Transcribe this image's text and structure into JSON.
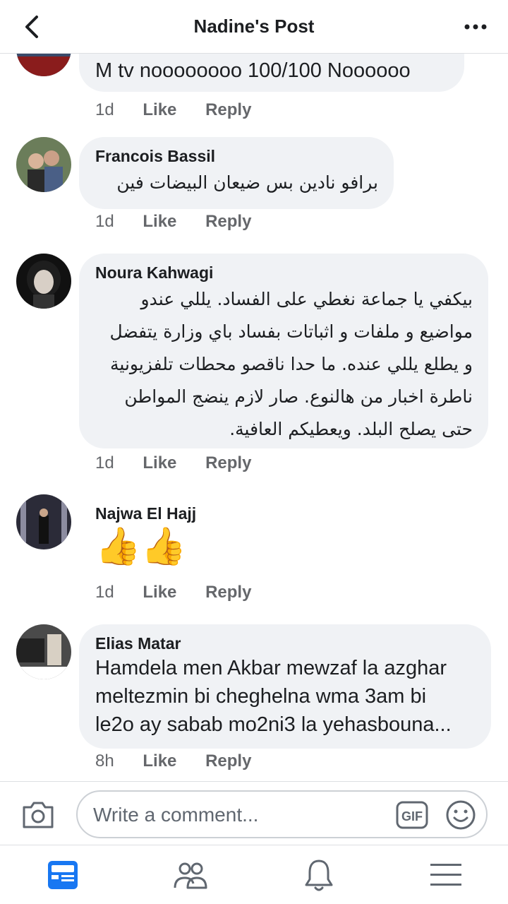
{
  "header": {
    "title": "Nadine's Post"
  },
  "comments": [
    {
      "author": "",
      "text": "M tv noooooooo 100/100 Noooooo",
      "time": "1d",
      "like": "Like",
      "reply": "Reply"
    },
    {
      "author": "Francois Bassil",
      "text": "برافو نادين    بس ضيعان البيضات فين",
      "time": "1d",
      "like": "Like",
      "reply": "Reply"
    },
    {
      "author": "Noura Kahwagi",
      "lines": [
        "بيكفي يا جماعة نغطي على الفساد. يللي عندو",
        "مواضيع و ملفات و اثباتات بفساد باي وزارة يتفضل",
        "و يطلع يللي عنده. ما حدا ناقصو محطات تلفزيونية",
        "ناطرة اخبار من هالنوع. صار لازم ينضج المواطن",
        "حتى يصلح البلد. ويعطيكم العافية."
      ],
      "time": "1d",
      "like": "Like",
      "reply": "Reply"
    },
    {
      "author": "Najwa El Hajj",
      "emoji": "👍👍",
      "time": "1d",
      "like": "Like",
      "reply": "Reply"
    },
    {
      "author": "Elias Matar",
      "lines": [
        "Hamdela men Akbar mewzaf la azghar",
        "meltezmin bi cheghelna wma 3am bi",
        "le2o ay sabab mo2ni3 la yehasbouna..."
      ],
      "time": "8h",
      "like": "Like",
      "reply": "Reply"
    }
  ],
  "composer": {
    "placeholder": "Write a comment...",
    "gif_label": "GIF"
  },
  "tabs": [
    "news-feed",
    "friends",
    "notifications",
    "menu"
  ],
  "colors": {
    "accent": "#1877f2",
    "bubble": "#f0f2f5",
    "meta": "#65676b"
  }
}
